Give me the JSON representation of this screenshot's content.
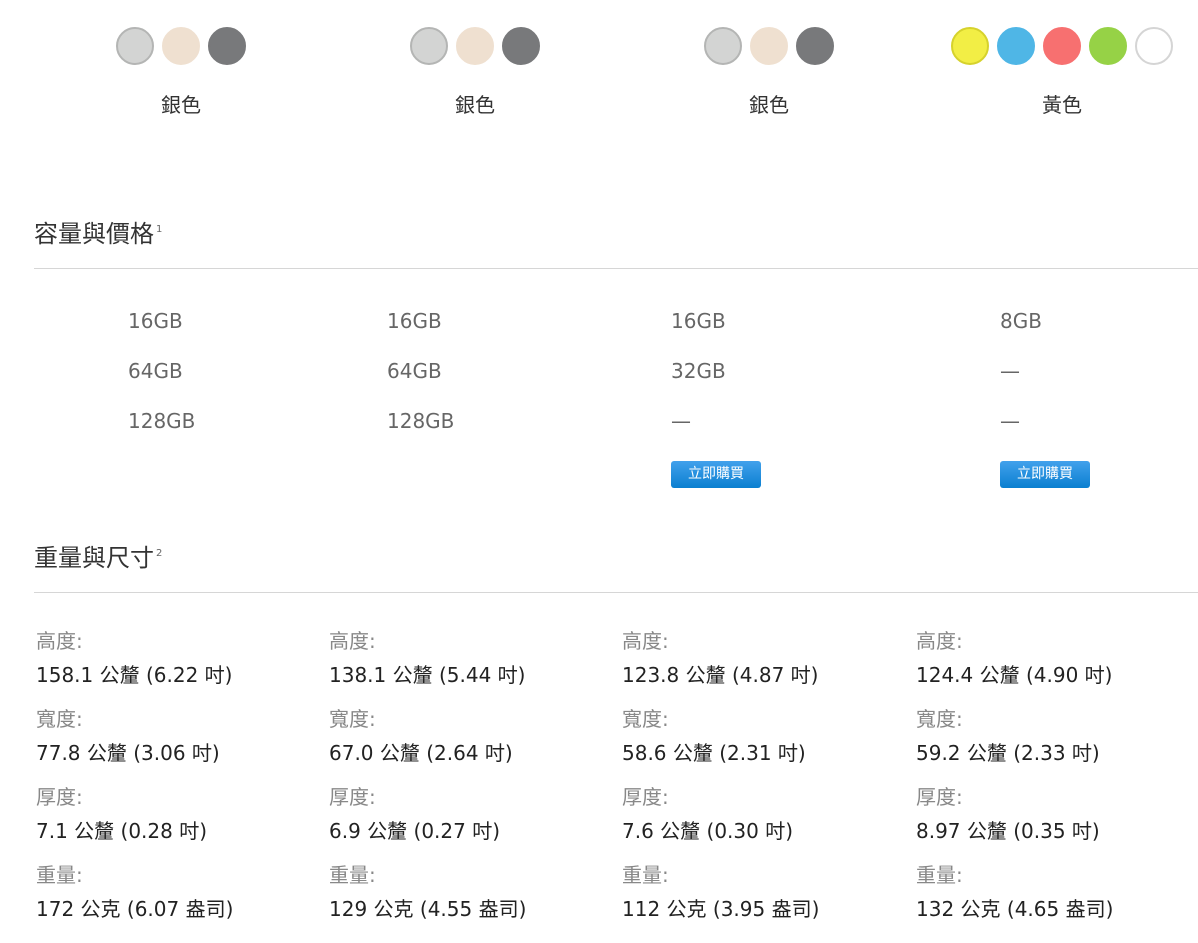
{
  "colors": [
    {
      "swatches": [
        "#d3d4d3",
        "#efe0d0",
        "#78797b"
      ],
      "borders": [
        "#b4b5b4",
        "#efe0d0",
        "#78797b"
      ],
      "name": "銀色"
    },
    {
      "swatches": [
        "#d3d4d3",
        "#efe0d0",
        "#78797b"
      ],
      "borders": [
        "#b4b5b4",
        "#efe0d0",
        "#78797b"
      ],
      "name": "銀色"
    },
    {
      "swatches": [
        "#d3d4d3",
        "#efe0d0",
        "#78797b"
      ],
      "borders": [
        "#b4b5b4",
        "#efe0d0",
        "#78797b"
      ],
      "name": "銀色"
    },
    {
      "swatches": [
        "#f2ee45",
        "#4fb6e6",
        "#f77070",
        "#96d246",
        "#ffffff"
      ],
      "borders": [
        "#d6d22c",
        "#4fb6e6",
        "#f77070",
        "#96d246",
        "#d5d5d5"
      ],
      "name": "黃色"
    }
  ],
  "capacity": {
    "title": "容量與價格",
    "footnote": "1",
    "columns": [
      {
        "items": [
          "16GB",
          "64GB",
          "128GB"
        ]
      },
      {
        "items": [
          "16GB",
          "64GB",
          "128GB"
        ]
      },
      {
        "items": [
          "16GB",
          "32GB",
          "—"
        ],
        "buy_label": "立即購買"
      },
      {
        "items": [
          "8GB",
          "—",
          "—"
        ],
        "buy_label": "立即購買"
      }
    ]
  },
  "dimensions": {
    "title": "重量與尺寸",
    "footnote": "2",
    "labels": {
      "height": "高度:",
      "width": "寬度:",
      "depth": "厚度:",
      "weight": "重量:"
    },
    "columns": [
      {
        "height": "158.1 公釐 (6.22 吋)",
        "width": "77.8 公釐 (3.06 吋)",
        "depth": "7.1 公釐 (0.28 吋)",
        "weight": "172 公克 (6.07 盎司)"
      },
      {
        "height": "138.1 公釐 (5.44 吋)",
        "width": "67.0 公釐 (2.64 吋)",
        "depth": "6.9 公釐 (0.27 吋)",
        "weight": "129 公克 (4.55 盎司)"
      },
      {
        "height": "123.8 公釐 (4.87 吋)",
        "width": "58.6 公釐 (2.31 吋)",
        "depth": "7.6 公釐 (0.30 吋)",
        "weight": "112 公克 (3.95 盎司)"
      },
      {
        "height": "124.4 公釐 (4.90 吋)",
        "width": "59.2 公釐 (2.33 吋)",
        "depth": "8.97 公釐 (0.35 吋)",
        "weight": "132 公克 (4.65 盎司)"
      }
    ]
  }
}
